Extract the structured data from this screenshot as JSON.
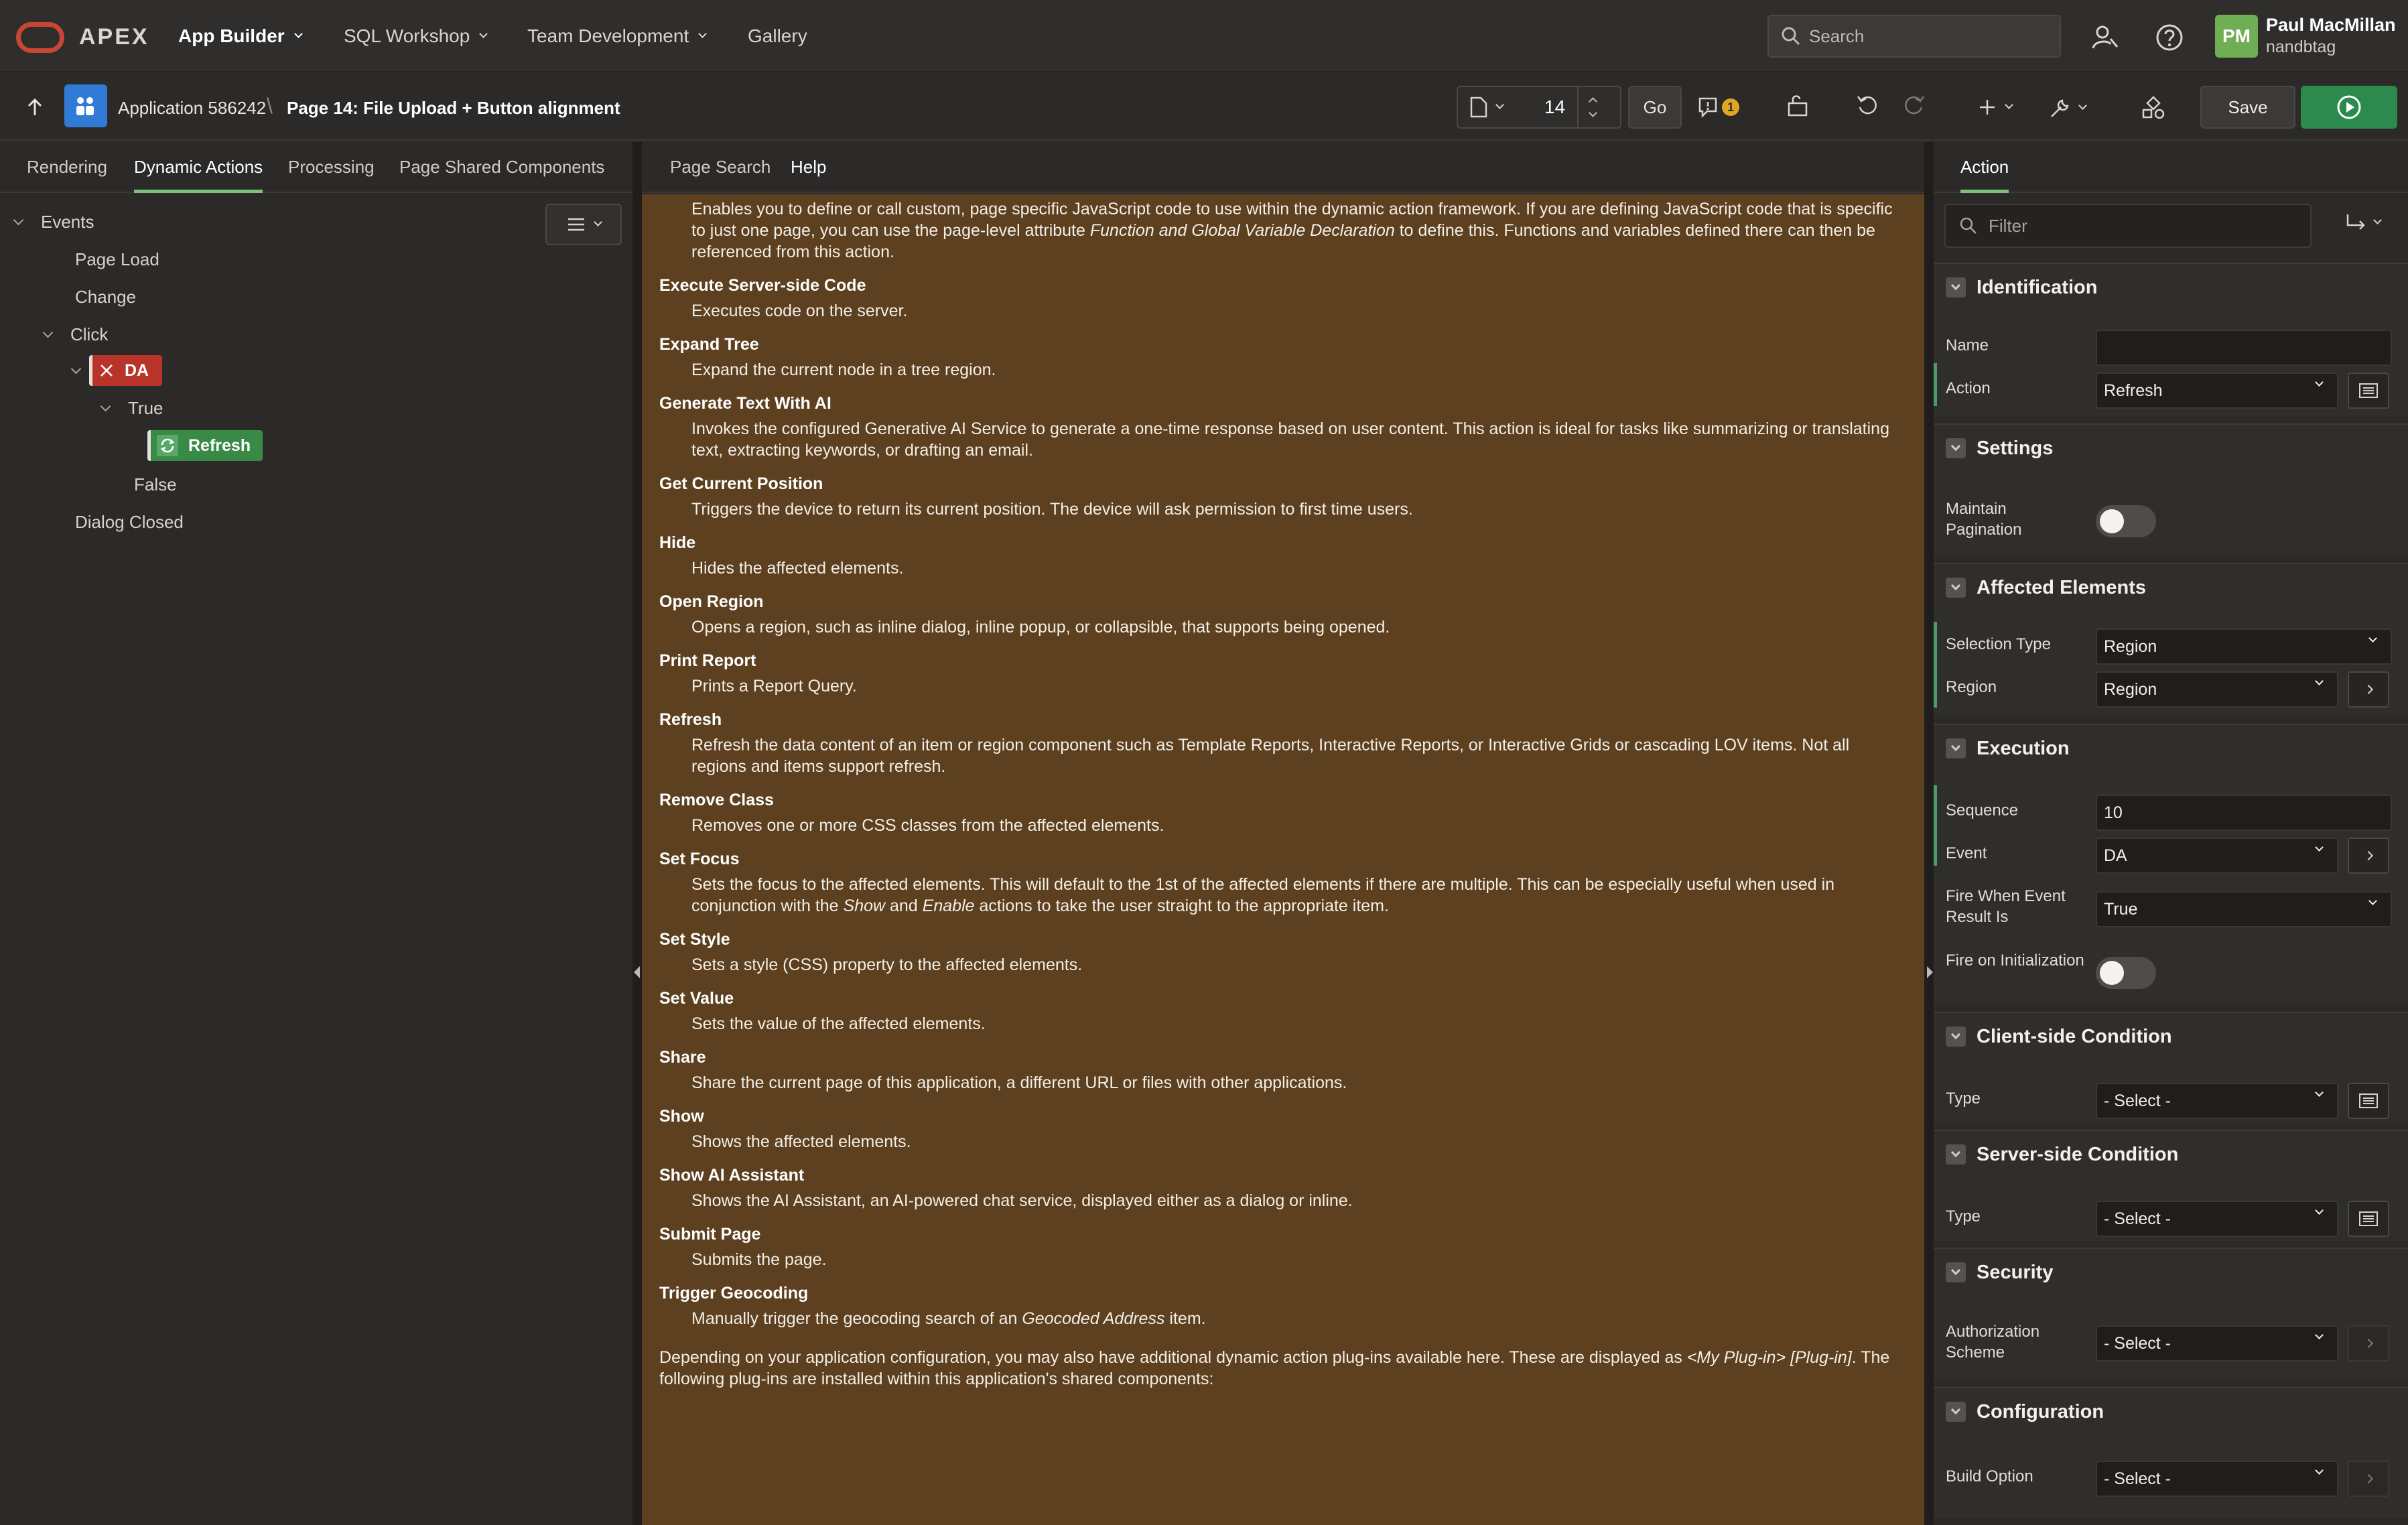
{
  "topnav": {
    "brand": "APEX",
    "items": [
      {
        "label": "App Builder",
        "has_menu": true
      },
      {
        "label": "SQL Workshop",
        "has_menu": true
      },
      {
        "label": "Team Development",
        "has_menu": true
      },
      {
        "label": "Gallery",
        "has_menu": false
      }
    ],
    "search_placeholder": "Search",
    "user": {
      "initials": "PM",
      "name": "Paul MacMillan",
      "workspace": "nandbtag"
    }
  },
  "toolbar": {
    "application": "Application 586242",
    "page": "Page 14: File Upload + Button alignment",
    "page_number": "14",
    "go_label": "Go",
    "warnings_count": "1",
    "save_label": "Save"
  },
  "left": {
    "tabs": [
      "Rendering",
      "Dynamic Actions",
      "Processing",
      "Page Shared Components"
    ],
    "active_tab": "Dynamic Actions",
    "tree": {
      "events": "Events",
      "page_load": "Page Load",
      "change": "Change",
      "click": "Click",
      "da": "DA",
      "true": "True",
      "refresh": "Refresh",
      "false": "False",
      "dialog_closed": "Dialog Closed"
    }
  },
  "center": {
    "tabs": [
      "Page Search",
      "Help"
    ],
    "active_tab": "Help",
    "intro_1": "Enables you to define or call custom, page specific JavaScript code to use within the dynamic action framework. If you are defining JavaScript code that is specific to just one page, you can use the page-level attribute ",
    "intro_em": "Function and Global Variable Declaration",
    "intro_2": " to define this. Functions and variables defined there can then be referenced from this action.",
    "entries": [
      {
        "title": "Execute Server-side Code",
        "desc": "Executes code on the server."
      },
      {
        "title": "Expand Tree",
        "desc": "Expand the current node in a tree region."
      },
      {
        "title": "Generate Text With AI",
        "desc": "Invokes the configured Generative AI Service to generate a one-time response based on user content. This action is ideal for tasks like summarizing or translating text, extracting keywords, or drafting an email."
      },
      {
        "title": "Get Current Position",
        "desc": "Triggers the device to return its current position. The device will ask permission to first time users."
      },
      {
        "title": "Hide",
        "desc": "Hides the affected elements."
      },
      {
        "title": "Open Region",
        "desc": "Opens a region, such as inline dialog, inline popup, or collapsible, that supports being opened."
      },
      {
        "title": "Print Report",
        "desc": "Prints a Report Query."
      },
      {
        "title": "Refresh",
        "desc": "Refresh the data content of an item or region component such as Template Reports, Interactive Reports, or Interactive Grids or cascading LOV items. Not all regions and items support refresh."
      },
      {
        "title": "Remove Class",
        "desc": "Removes one or more CSS classes from the affected elements."
      }
    ],
    "set_focus_title": "Set Focus",
    "set_focus_1": "Sets the focus to the affected elements. This will default to the 1st of the affected elements if there are multiple. This can be especially useful when used in conjunction with the ",
    "set_focus_em1": "Show",
    "set_focus_2": " and ",
    "set_focus_em2": "Enable",
    "set_focus_3": " actions to take the user straight to the appropriate item.",
    "entries2": [
      {
        "title": "Set Style",
        "desc": "Sets a style (CSS) property to the affected elements."
      },
      {
        "title": "Set Value",
        "desc": "Sets the value of the affected elements."
      },
      {
        "title": "Share",
        "desc": "Share the current page of this application, a different URL or files with other applications."
      },
      {
        "title": "Show",
        "desc": "Shows the affected elements."
      },
      {
        "title": "Show AI Assistant",
        "desc": "Shows the AI Assistant, an AI-powered chat service, displayed either as a dialog or inline."
      },
      {
        "title": "Submit Page",
        "desc": "Submits the page."
      }
    ],
    "geocode_title": "Trigger Geocoding",
    "geocode_1": "Manually trigger the geocoding search of an ",
    "geocode_em": "Geocoded Address",
    "geocode_2": " item.",
    "footer_1": "Depending on your application configuration, you may also have additional dynamic action plug-ins available here. These are displayed as ",
    "footer_em": "<My Plug-in> [Plug-in]",
    "footer_2": ". The following plug-ins are installed within this application's shared components:"
  },
  "right": {
    "tab": "Action",
    "filter_placeholder": "Filter",
    "identification": {
      "title": "Identification",
      "name_label": "Name",
      "name_value": "",
      "action_label": "Action",
      "action_value": "Refresh"
    },
    "settings": {
      "title": "Settings",
      "maintain_pagination": "Maintain Pagination",
      "maintain_pagination_on": false
    },
    "affected": {
      "title": "Affected Elements",
      "selection_type_label": "Selection Type",
      "selection_type_value": "Region",
      "region_label": "Region",
      "region_value": "Region"
    },
    "execution": {
      "title": "Execution",
      "sequence_label": "Sequence",
      "sequence_value": "10",
      "event_label": "Event",
      "event_value": "DA",
      "fire_when_label": "Fire When Event Result Is",
      "fire_when_value": "True",
      "fire_init_label": "Fire on Initialization",
      "fire_init_on": false
    },
    "client_condition": {
      "title": "Client-side Condition",
      "type_label": "Type",
      "type_value": "- Select -"
    },
    "server_condition": {
      "title": "Server-side Condition",
      "type_label": "Type",
      "type_value": "- Select -"
    },
    "security": {
      "title": "Security",
      "auth_label": "Authorization Scheme",
      "auth_value": "- Select -"
    },
    "configuration": {
      "title": "Configuration",
      "build_label": "Build Option",
      "build_value": "- Select -"
    }
  },
  "colors": {
    "brand_red": "#c74634",
    "help_bg": "#5c401f",
    "run_green": "#2d8a4e",
    "da_red": "#b8342a",
    "refresh_green": "#3a8a47",
    "tab_underline": "#7fbf7f"
  }
}
